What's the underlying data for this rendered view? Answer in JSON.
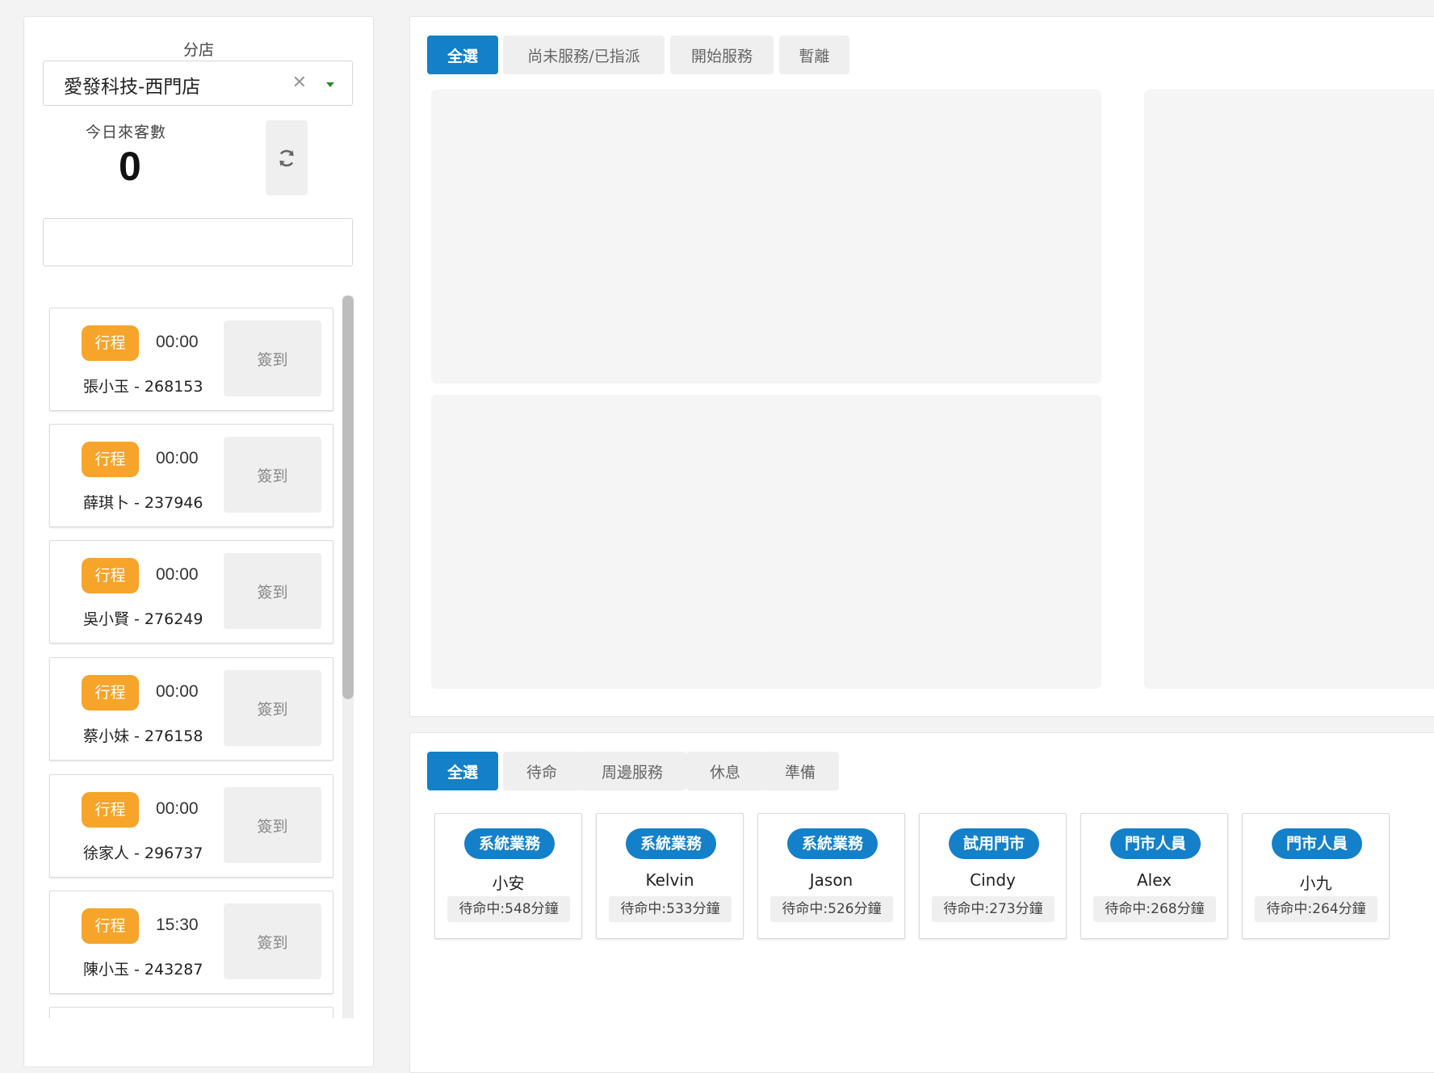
{
  "sidebar": {
    "branch_label": "分店",
    "branch_value": "愛發科技-西門店",
    "clear_symbol": "✕",
    "visitor_label": "今日來客數",
    "visitor_count": "0",
    "search_value": "",
    "checkin_items": [
      {
        "tag": "行程",
        "time": "00:00",
        "name": "張小玉 - 268153",
        "button": "簽到"
      },
      {
        "tag": "行程",
        "time": "00:00",
        "name": "薛琪卜 - 237946",
        "button": "簽到"
      },
      {
        "tag": "行程",
        "time": "00:00",
        "name": "吳小賢 - 276249",
        "button": "簽到"
      },
      {
        "tag": "行程",
        "time": "00:00",
        "name": "蔡小妹 - 276158",
        "button": "簽到"
      },
      {
        "tag": "行程",
        "time": "00:00",
        "name": "徐家人 - 296737",
        "button": "簽到"
      },
      {
        "tag": "行程",
        "time": "15:30",
        "name": "陳小玉 - 243287",
        "button": "簽到"
      }
    ]
  },
  "service_panel": {
    "tabs": [
      {
        "label": "全選",
        "active": true
      },
      {
        "label": "尚未服務/已指派",
        "active": false
      },
      {
        "label": "開始服務",
        "active": false
      },
      {
        "label": "暫離",
        "active": false
      }
    ]
  },
  "staff_panel": {
    "tabs": [
      {
        "label": "全選",
        "active": true
      },
      {
        "label": "待命",
        "active": false
      },
      {
        "label": "周邊服務",
        "active": false
      },
      {
        "label": "休息",
        "active": false
      },
      {
        "label": "準備",
        "active": false
      }
    ],
    "staff": [
      {
        "role": "系統業務",
        "name": "小安",
        "status": "待命中:548分鐘"
      },
      {
        "role": "系統業務",
        "name": "Kelvin",
        "status": "待命中:533分鐘"
      },
      {
        "role": "系統業務",
        "name": "Jason",
        "status": "待命中:526分鐘"
      },
      {
        "role": "試用門市",
        "name": "Cindy",
        "status": "待命中:273分鐘"
      },
      {
        "role": "門市人員",
        "name": "Alex",
        "status": "待命中:268分鐘"
      },
      {
        "role": "門市人員",
        "name": "小九",
        "status": "待命中:264分鐘"
      }
    ]
  },
  "colors": {
    "accent_blue": "#1380c9",
    "tag_orange": "#f6a42a",
    "dropdown_arrow": "#2a8a2a"
  }
}
